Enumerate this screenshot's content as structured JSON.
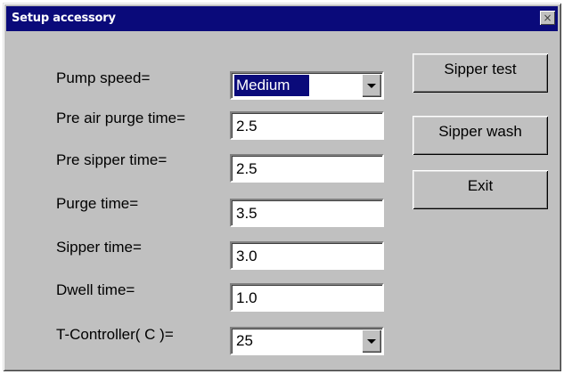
{
  "window": {
    "title": "Setup accessory",
    "close_glyph": "×"
  },
  "fields": {
    "pump_speed": {
      "label": "Pump speed=",
      "value": "Medium"
    },
    "pre_air_purge_time": {
      "label": "Pre air purge time=",
      "value": "2.5"
    },
    "pre_sipper_time": {
      "label": "Pre sipper time=",
      "value": "2.5"
    },
    "purge_time": {
      "label": "Purge time=",
      "value": "3.5"
    },
    "sipper_time": {
      "label": "Sipper time=",
      "value": "3.0"
    },
    "dwell_time": {
      "label": "Dwell time=",
      "value": "1.0"
    },
    "t_controller": {
      "label": "T-Controller( C )=",
      "value": "25"
    }
  },
  "buttons": {
    "sipper_test": "Sipper test",
    "sipper_wash": "Sipper wash",
    "exit": "Exit"
  },
  "colors": {
    "titlebar": "#0a0a7a",
    "face": "#c0c0c0"
  }
}
